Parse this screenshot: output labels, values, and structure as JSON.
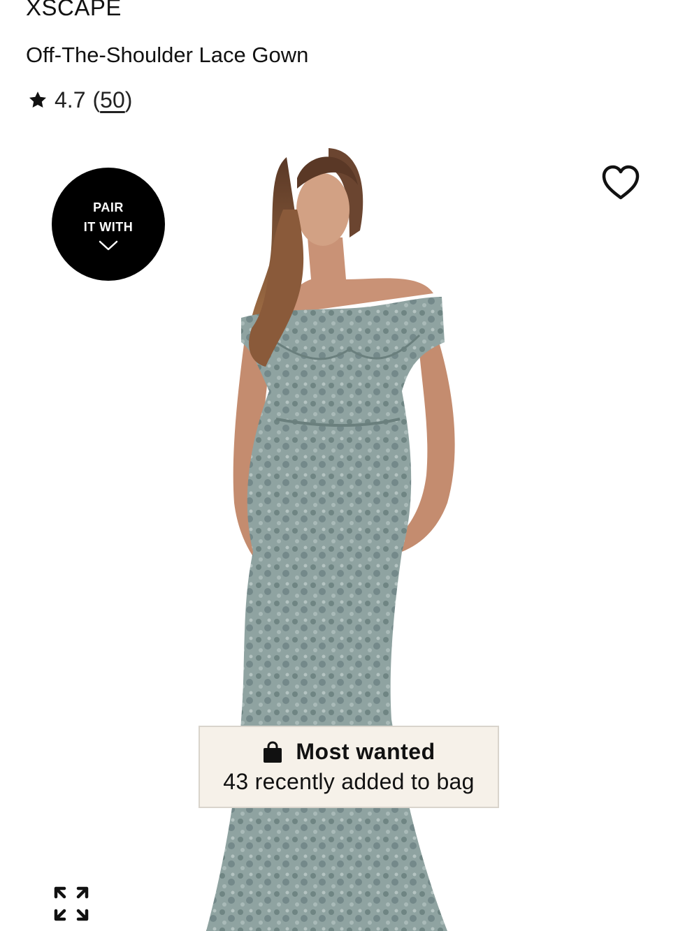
{
  "product": {
    "brand": "XSCAPE",
    "name": "Off-The-Shoulder Lace Gown",
    "rating": "4.7",
    "review_count": "50",
    "review_open": "(",
    "review_close": ")"
  },
  "pair_it_with": {
    "line1": "PAIR",
    "line2": "IT WITH"
  },
  "badge": {
    "title": "Most wanted",
    "subtitle": "43 recently added to bag"
  },
  "icons": {
    "rating": "star-icon",
    "wishlist": "heart-icon",
    "pair": "chevron-down-icon",
    "badge": "shopping-bag-icon",
    "expand": "expand-icon"
  },
  "colors": {
    "dress": "#8a9d9b",
    "badge_bg": "#f6f1e9"
  }
}
